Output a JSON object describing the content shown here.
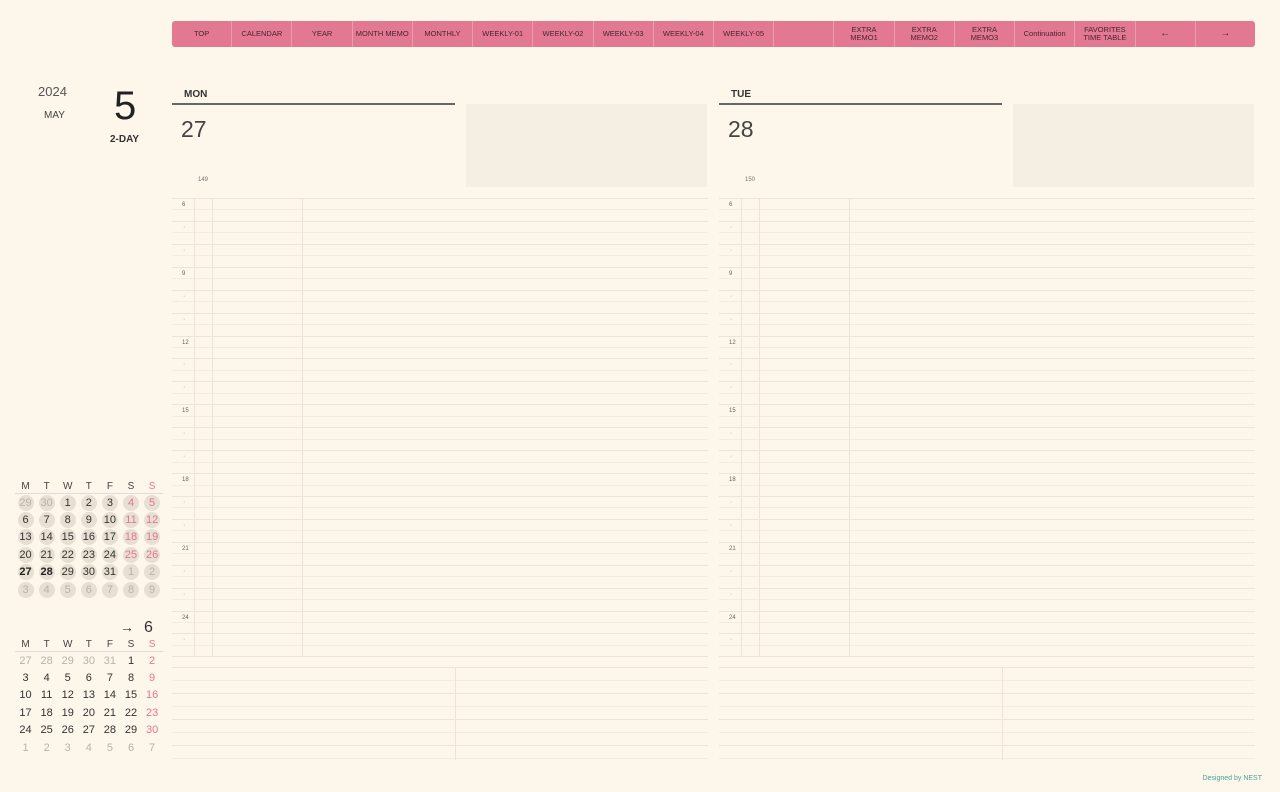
{
  "nav": [
    "TOP",
    "CALENDAR",
    "YEAR",
    "MONTH MEMO",
    "MONTHLY",
    "WEEKLY-01",
    "WEEKLY-02",
    "WEEKLY-03",
    "WEEKLY-04",
    "WEEKLY-05",
    "",
    "EXTRA\nMEMO1",
    "EXTRA\nMEMO2",
    "EXTRA\nMEMO3",
    "Continuation",
    "FAVORITES\nTIME TABLE",
    "←",
    "→"
  ],
  "header": {
    "year": "2024",
    "month_name": "MAY",
    "month_num": "5",
    "view": "2-DAY"
  },
  "days": [
    {
      "dow": "MON",
      "date": "27",
      "doy": "149"
    },
    {
      "dow": "TUE",
      "date": "28",
      "doy": "150"
    }
  ],
  "hour_labels": [
    "6",
    "9",
    "12",
    "15",
    "18",
    "21",
    "24"
  ],
  "calendar_may": {
    "weekdays": [
      "M",
      "T",
      "W",
      "T",
      "F",
      "S",
      "S"
    ],
    "weeks": [
      [
        "29",
        "30",
        "1",
        "2",
        "3",
        "4",
        "5"
      ],
      [
        "6",
        "7",
        "8",
        "9",
        "10",
        "11",
        "12"
      ],
      [
        "13",
        "14",
        "15",
        "16",
        "17",
        "18",
        "19"
      ],
      [
        "20",
        "21",
        "22",
        "23",
        "24",
        "25",
        "26"
      ],
      [
        "27",
        "28",
        "29",
        "30",
        "31",
        "1",
        "2"
      ],
      [
        "3",
        "4",
        "5",
        "6",
        "7",
        "8",
        "9"
      ]
    ]
  },
  "calendar_june": {
    "arrow": "→",
    "month": "6",
    "weekdays": [
      "M",
      "T",
      "W",
      "T",
      "F",
      "S",
      "S"
    ],
    "weeks": [
      [
        "27",
        "28",
        "29",
        "30",
        "31",
        "1",
        "2"
      ],
      [
        "3",
        "4",
        "5",
        "6",
        "7",
        "8",
        "9"
      ],
      [
        "10",
        "11",
        "12",
        "13",
        "14",
        "15",
        "16"
      ],
      [
        "17",
        "18",
        "19",
        "20",
        "21",
        "22",
        "23"
      ],
      [
        "24",
        "25",
        "26",
        "27",
        "28",
        "29",
        "30"
      ],
      [
        "1",
        "2",
        "3",
        "4",
        "5",
        "6",
        "7"
      ]
    ]
  },
  "credit": "Designed by NEST",
  "colors": {
    "accent": "#e27891",
    "background": "#fdf6ea",
    "memo": "#f5eee2"
  }
}
